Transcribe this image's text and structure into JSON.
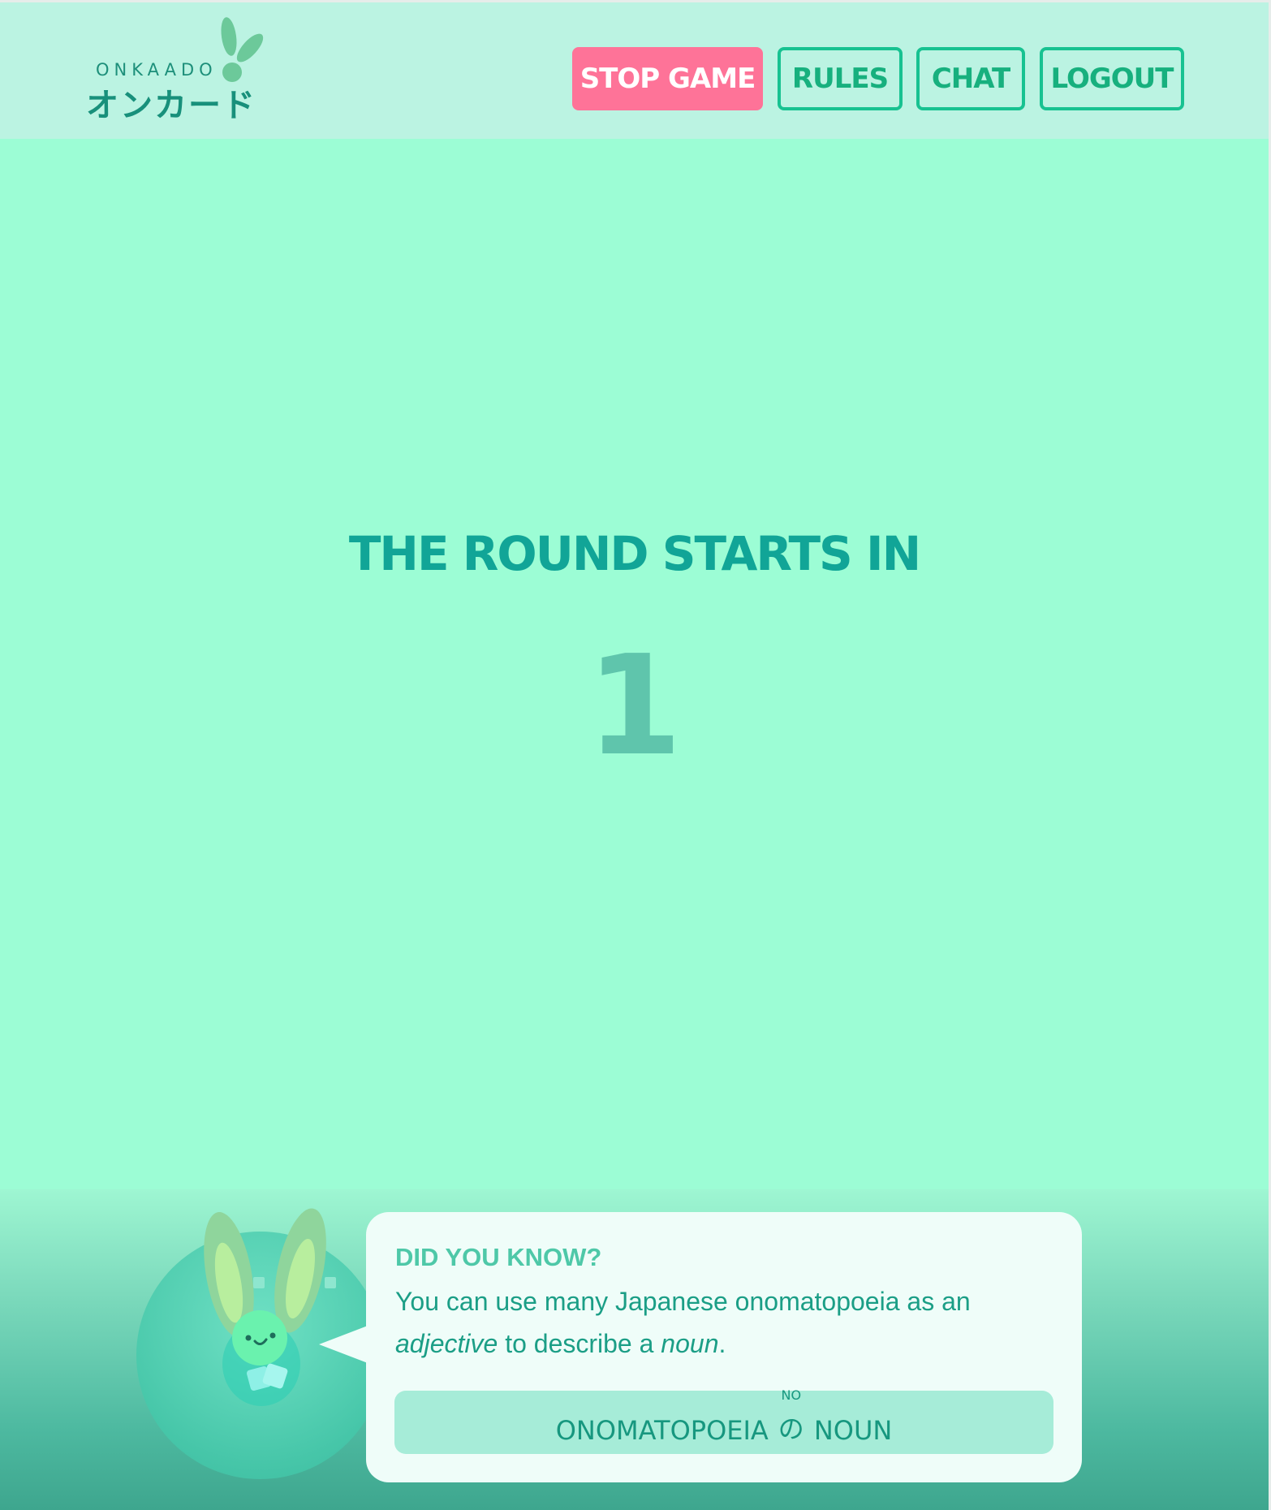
{
  "app": {
    "logo_en": "ONKAADO",
    "logo_jp": "オンカード"
  },
  "nav": {
    "stop_game": "STOP GAME",
    "rules": "RULES",
    "chat": "CHAT",
    "logout": "LOGOUT"
  },
  "countdown": {
    "title": "THE ROUND STARTS IN",
    "value": "1"
  },
  "tip": {
    "heading": "DID YOU KNOW?",
    "text_part1": "You can use many Japanese onomatopoeia as an ",
    "text_em1": "adjective",
    "text_part2": " to describe a ",
    "text_em2": "noun",
    "text_part3": ".",
    "pattern_left": "ONOMATOPOEIA",
    "pattern_particle": "の",
    "pattern_particle_reading": "NO",
    "pattern_right": "NOUN"
  },
  "colors": {
    "background": "#9cfdd5",
    "header": "#bbf3e2",
    "stop_button": "#fe7398",
    "outline_button": "#17c291",
    "title_text": "#11a597",
    "countdown_number": "#5fc5ac"
  }
}
